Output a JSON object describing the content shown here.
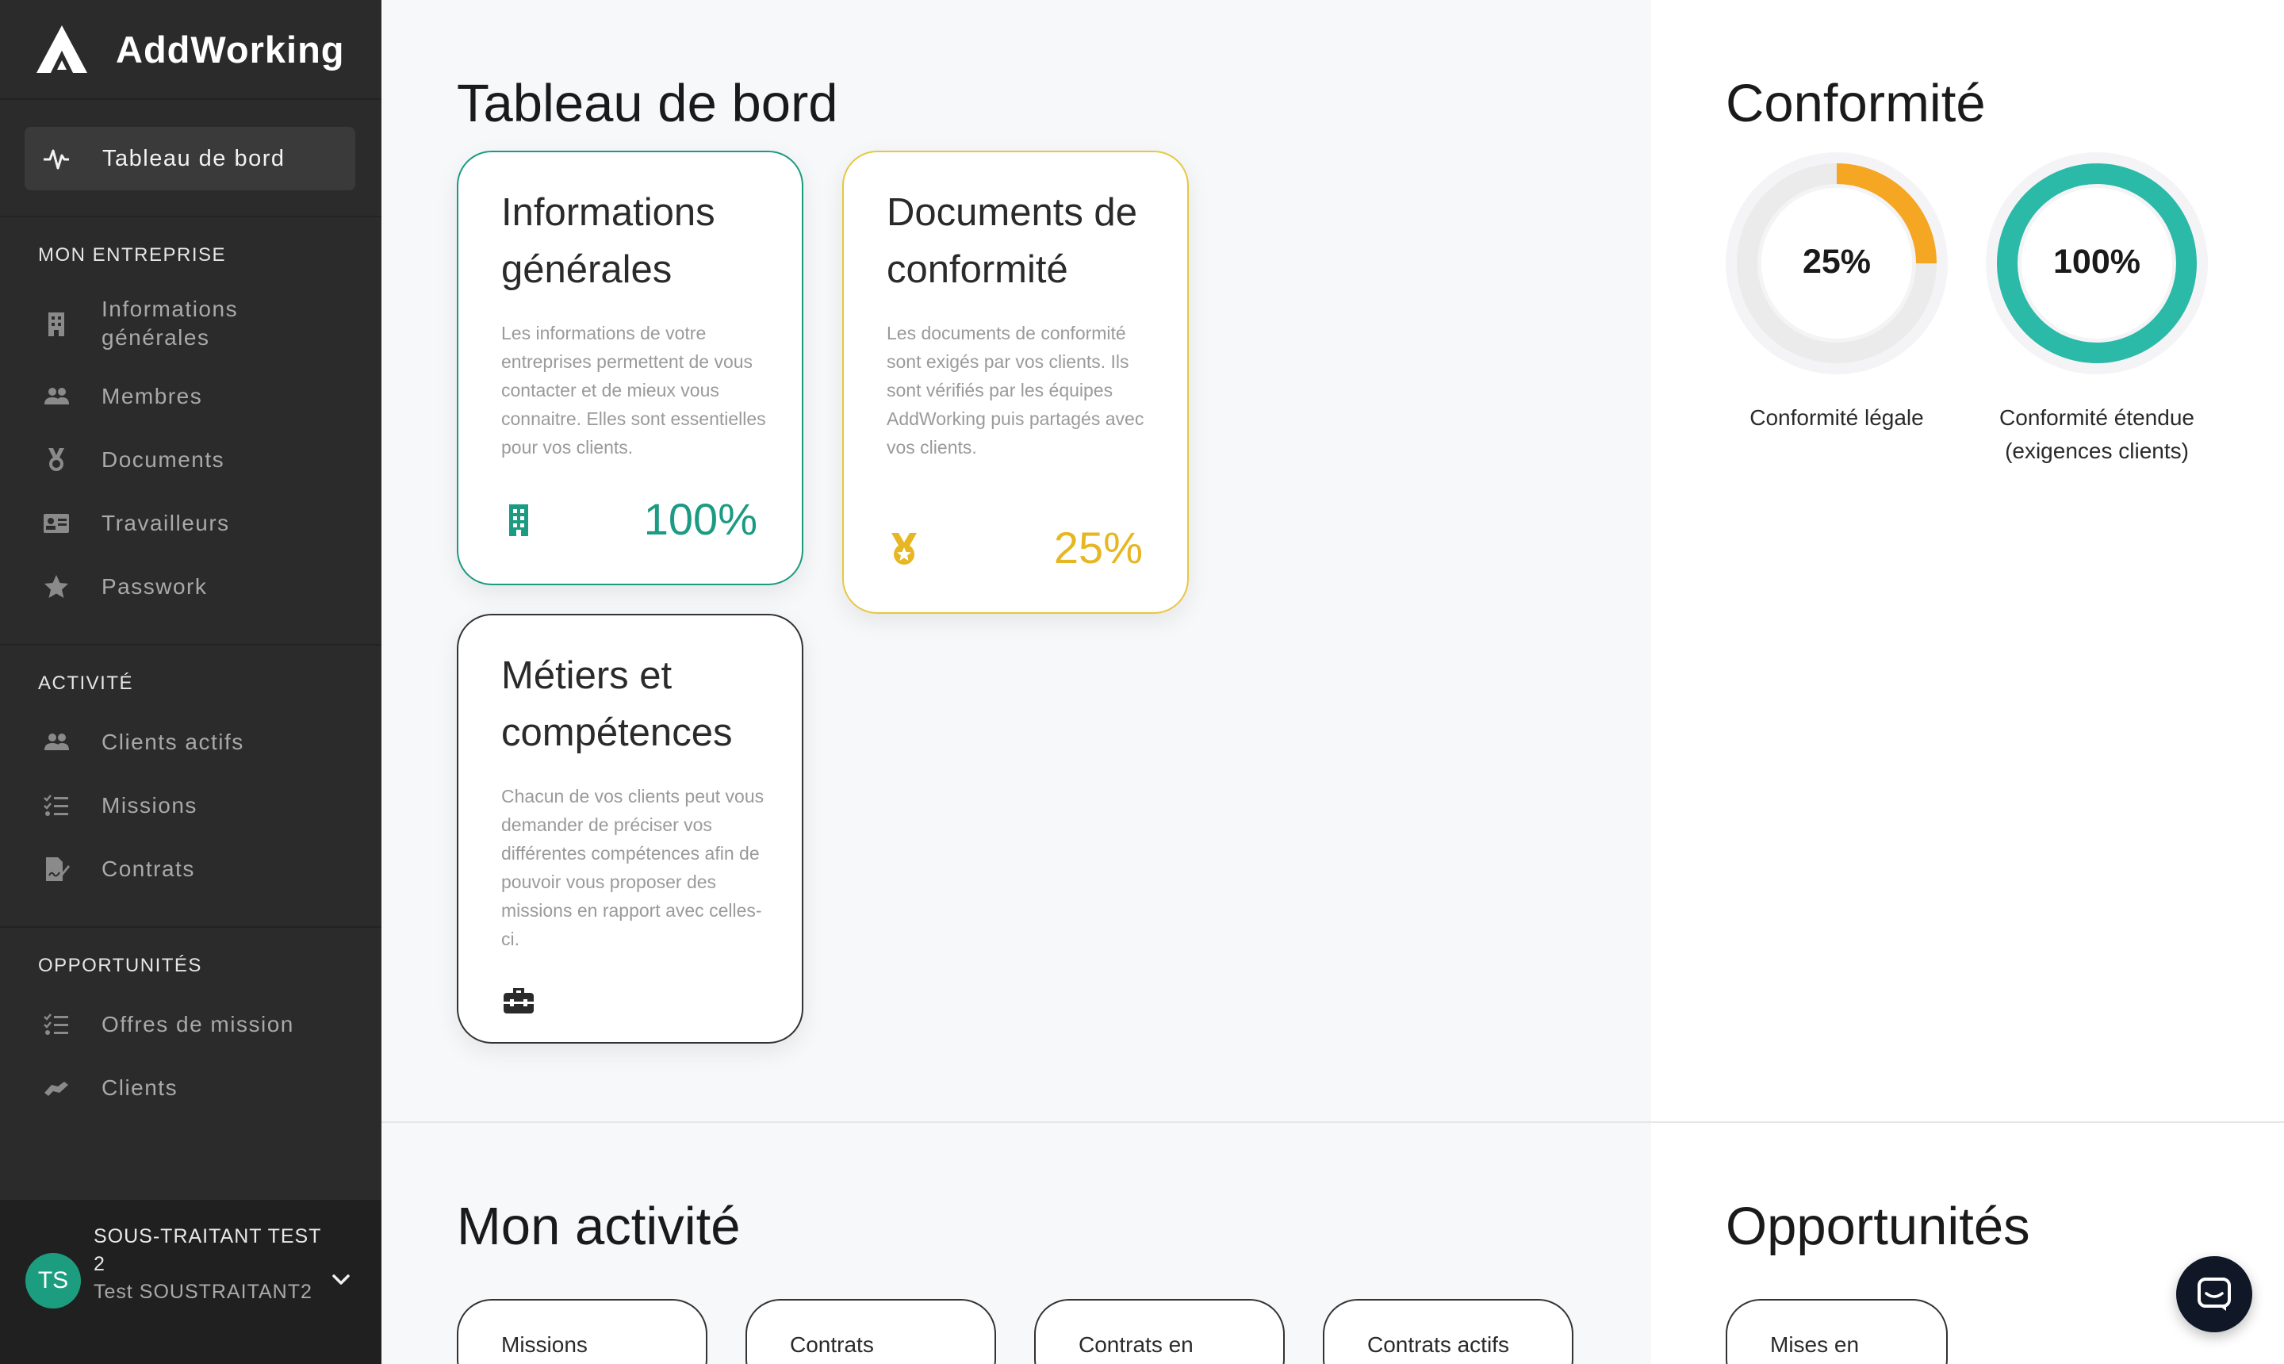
{
  "app": {
    "brand": "AddWorking"
  },
  "sidebar": {
    "active_item": "Tableau de bord",
    "sections": [
      {
        "title": "MON ENTREPRISE",
        "items": [
          {
            "label": "Informations générales",
            "icon": "building-icon"
          },
          {
            "label": "Membres",
            "icon": "users-icon"
          },
          {
            "label": "Documents",
            "icon": "medal-icon"
          },
          {
            "label": "Travailleurs",
            "icon": "id-card-icon"
          },
          {
            "label": "Passwork",
            "icon": "star-icon"
          }
        ]
      },
      {
        "title": "ACTIVITÉ",
        "items": [
          {
            "label": "Clients actifs",
            "icon": "users-icon"
          },
          {
            "label": "Missions",
            "icon": "tasks-icon"
          },
          {
            "label": "Contrats",
            "icon": "file-signature-icon"
          }
        ]
      },
      {
        "title": "OPPORTUNITÉS",
        "items": [
          {
            "label": "Offres de mission",
            "icon": "tasks-icon"
          },
          {
            "label": "Clients",
            "icon": "handshake-icon"
          }
        ]
      }
    ],
    "user": {
      "initials": "TS",
      "company": "SOUS-TRAITANT TEST 2",
      "name": "Test SOUSTRAITANT2"
    }
  },
  "dashboard": {
    "title": "Tableau de bord",
    "cards": [
      {
        "title": "Informations générales",
        "description": "Les informations de votre entreprises permettent de vous contacter et de mieux vous connaitre. Elles sont essentielles pour vos clients.",
        "percent_label": "100%",
        "percent": 100,
        "color": "#1a9b82",
        "icon": "building-icon"
      },
      {
        "title": "Documents de conformité",
        "description": "Les documents de conformité sont exigés par vos clients. Ils sont vérifiés par les équipes AddWorking puis partagés avec vos clients.",
        "percent_label": "25%",
        "percent": 25,
        "color": "#e6b722",
        "icon": "medal-icon"
      },
      {
        "title": "Métiers et compétences",
        "description": "Chacun de vos clients peut vous demander de préciser vos différentes compétences afin de pouvoir vous proposer des missions en rapport avec celles-ci.",
        "color": "#333333",
        "icon": "toolbox-icon"
      }
    ]
  },
  "compliance": {
    "title": "Conformité",
    "gauges": [
      {
        "value": 25,
        "label_value": "25%",
        "label": "Conformité légale",
        "color": "#f5a623"
      },
      {
        "value": 100,
        "label_value": "100%",
        "label": "Conformité étendue (exigences clients)",
        "color": "#2bb9a8"
      }
    ]
  },
  "activity": {
    "title": "Mon activité",
    "cards": [
      "Missions",
      "Contrats",
      "Contrats en",
      "Contrats actifs"
    ]
  },
  "opportunities": {
    "title": "Opportunités",
    "cards": [
      "Mises en"
    ]
  }
}
